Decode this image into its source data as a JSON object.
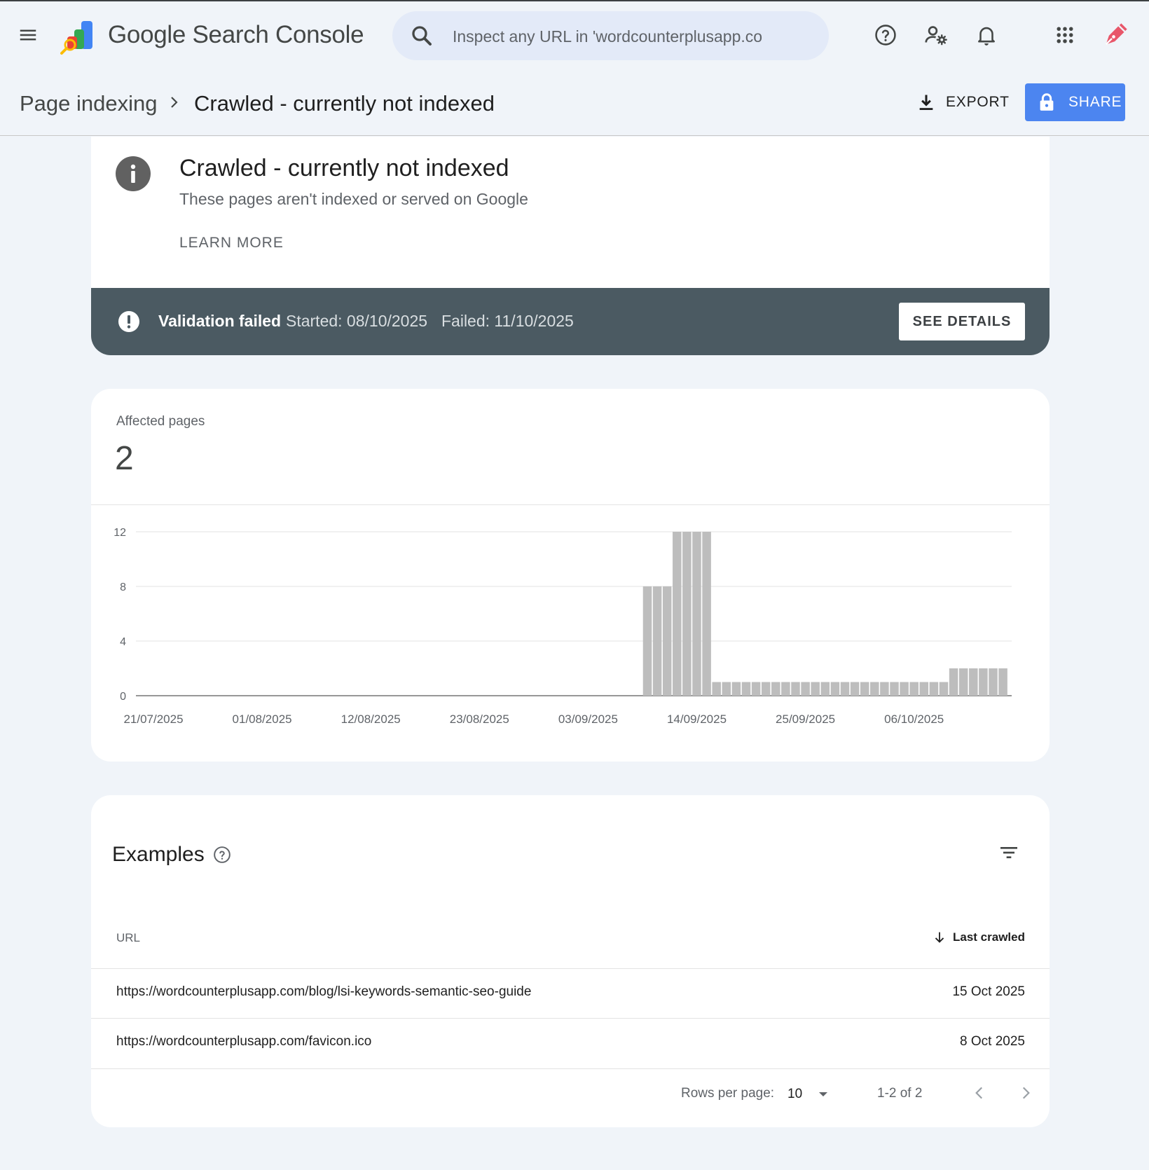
{
  "app": {
    "product_name": "Google Search Console"
  },
  "search": {
    "placeholder": "Inspect any URL in 'wordcounterplusapp.co"
  },
  "breadcrumb": {
    "parent": "Page indexing",
    "current": "Crawled - currently not indexed"
  },
  "toolbar": {
    "export_label": "EXPORT",
    "share_label": "SHARE"
  },
  "issue": {
    "title": "Crawled - currently not indexed",
    "description": "These pages aren't indexed or served on Google",
    "learn_more": "LEARN MORE"
  },
  "validation": {
    "status": "Validation failed",
    "started": "Started: 08/10/2025",
    "failed": "Failed: 11/10/2025",
    "details_button": "SEE DETAILS"
  },
  "metric": {
    "label": "Affected pages",
    "value": "2"
  },
  "chart_data": {
    "type": "bar",
    "title": "",
    "xlabel": "",
    "ylabel": "",
    "ylim": [
      0,
      12
    ],
    "y_ticks": [
      "0",
      "4",
      "8",
      "12"
    ],
    "x_ticks": [
      "21/07/2025",
      "01/08/2025",
      "12/08/2025",
      "23/08/2025",
      "03/09/2025",
      "14/09/2025",
      "25/09/2025",
      "06/10/2025"
    ],
    "x_start": "2025-07-21",
    "series": [
      {
        "color": "#bdbdbd",
        "points": [
          {
            "date": "2025-09-09",
            "value": 8
          },
          {
            "date": "2025-09-10",
            "value": 8
          },
          {
            "date": "2025-09-11",
            "value": 8
          },
          {
            "date": "2025-09-12",
            "value": 12
          },
          {
            "date": "2025-09-13",
            "value": 12
          },
          {
            "date": "2025-09-14",
            "value": 12
          },
          {
            "date": "2025-09-15",
            "value": 12
          },
          {
            "date": "2025-09-16",
            "value": 1
          },
          {
            "date": "2025-09-17",
            "value": 1
          },
          {
            "date": "2025-09-18",
            "value": 1
          },
          {
            "date": "2025-09-19",
            "value": 1
          },
          {
            "date": "2025-09-20",
            "value": 1
          },
          {
            "date": "2025-09-21",
            "value": 1
          },
          {
            "date": "2025-09-22",
            "value": 1
          },
          {
            "date": "2025-09-23",
            "value": 1
          },
          {
            "date": "2025-09-24",
            "value": 1
          },
          {
            "date": "2025-09-25",
            "value": 1
          },
          {
            "date": "2025-09-26",
            "value": 1
          },
          {
            "date": "2025-09-27",
            "value": 1
          },
          {
            "date": "2025-09-28",
            "value": 1
          },
          {
            "date": "2025-09-29",
            "value": 1
          },
          {
            "date": "2025-09-30",
            "value": 1
          },
          {
            "date": "2025-10-01",
            "value": 1
          },
          {
            "date": "2025-10-02",
            "value": 1
          },
          {
            "date": "2025-10-03",
            "value": 1
          },
          {
            "date": "2025-10-04",
            "value": 1
          },
          {
            "date": "2025-10-05",
            "value": 1
          },
          {
            "date": "2025-10-06",
            "value": 1
          },
          {
            "date": "2025-10-07",
            "value": 1
          },
          {
            "date": "2025-10-08",
            "value": 1
          },
          {
            "date": "2025-10-09",
            "value": 1
          },
          {
            "date": "2025-10-10",
            "value": 2
          },
          {
            "date": "2025-10-11",
            "value": 2
          },
          {
            "date": "2025-10-12",
            "value": 2
          },
          {
            "date": "2025-10-13",
            "value": 2
          },
          {
            "date": "2025-10-14",
            "value": 2
          },
          {
            "date": "2025-10-15",
            "value": 2
          }
        ]
      }
    ],
    "grid": true,
    "legend": "none"
  },
  "examples": {
    "title": "Examples",
    "columns": {
      "url": "URL",
      "last_crawled": "Last crawled"
    },
    "rows": [
      {
        "url": "https://wordcounterplusapp.com/blog/lsi-keywords-semantic-seo-guide",
        "last_crawled": "15 Oct 2025"
      },
      {
        "url": "https://wordcounterplusapp.com/favicon.ico",
        "last_crawled": "8 Oct 2025"
      }
    ],
    "pagination": {
      "rows_per_page_label": "Rows per page:",
      "rows_per_page_value": "10",
      "range": "1-2 of 2"
    }
  },
  "colors": {
    "accent": "#4c85f0",
    "banner": "#4b5a62",
    "background": "#f0f4f9",
    "bar": "#bdbdbd"
  },
  "icons": [
    "menu-icon",
    "search-console-logo",
    "search-icon",
    "help-icon",
    "manage-users-icon",
    "notifications-icon",
    "apps-grid-icon",
    "account-avatar-icon",
    "chevron-right-icon",
    "download-icon",
    "lock-icon",
    "info-icon",
    "alert-icon",
    "help-outline-icon",
    "filter-icon",
    "arrow-down-icon",
    "dropdown-arrow-icon",
    "chevron-left-icon"
  ]
}
